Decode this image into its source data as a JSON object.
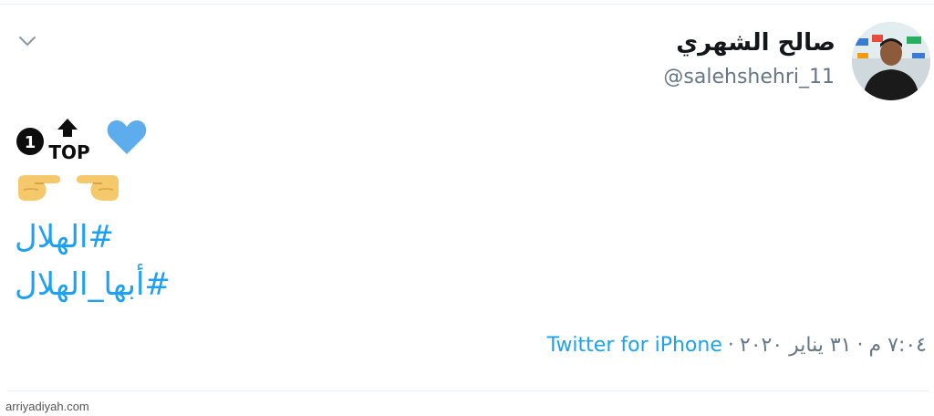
{
  "tweet": {
    "author": {
      "display_name": "صالح الشهري",
      "handle": "@salehshehri_11"
    },
    "emoji_line_1": {
      "icons": [
        "keycap-1-icon",
        "top-arrow-icon",
        "blue-heart-icon"
      ],
      "top_text": "TOP",
      "number_text": "1"
    },
    "emoji_line_2": {
      "icons": [
        "hand-pointing-right-icon",
        "hand-pointing-left-icon"
      ]
    },
    "hashtags": [
      "#الهلال",
      "#أبها_الهلال"
    ],
    "time": "٧:٠٤ م",
    "date": "٣١ يناير ٢٠٢٠",
    "separator": "·",
    "source": "Twitter for iPhone"
  },
  "colors": {
    "link": "#1da1f2",
    "secondary_text": "#657786",
    "primary_text": "#14171a",
    "heart": "#5dadec",
    "hand": "#f5c86b"
  },
  "watermark": "arriyadiyah.com"
}
